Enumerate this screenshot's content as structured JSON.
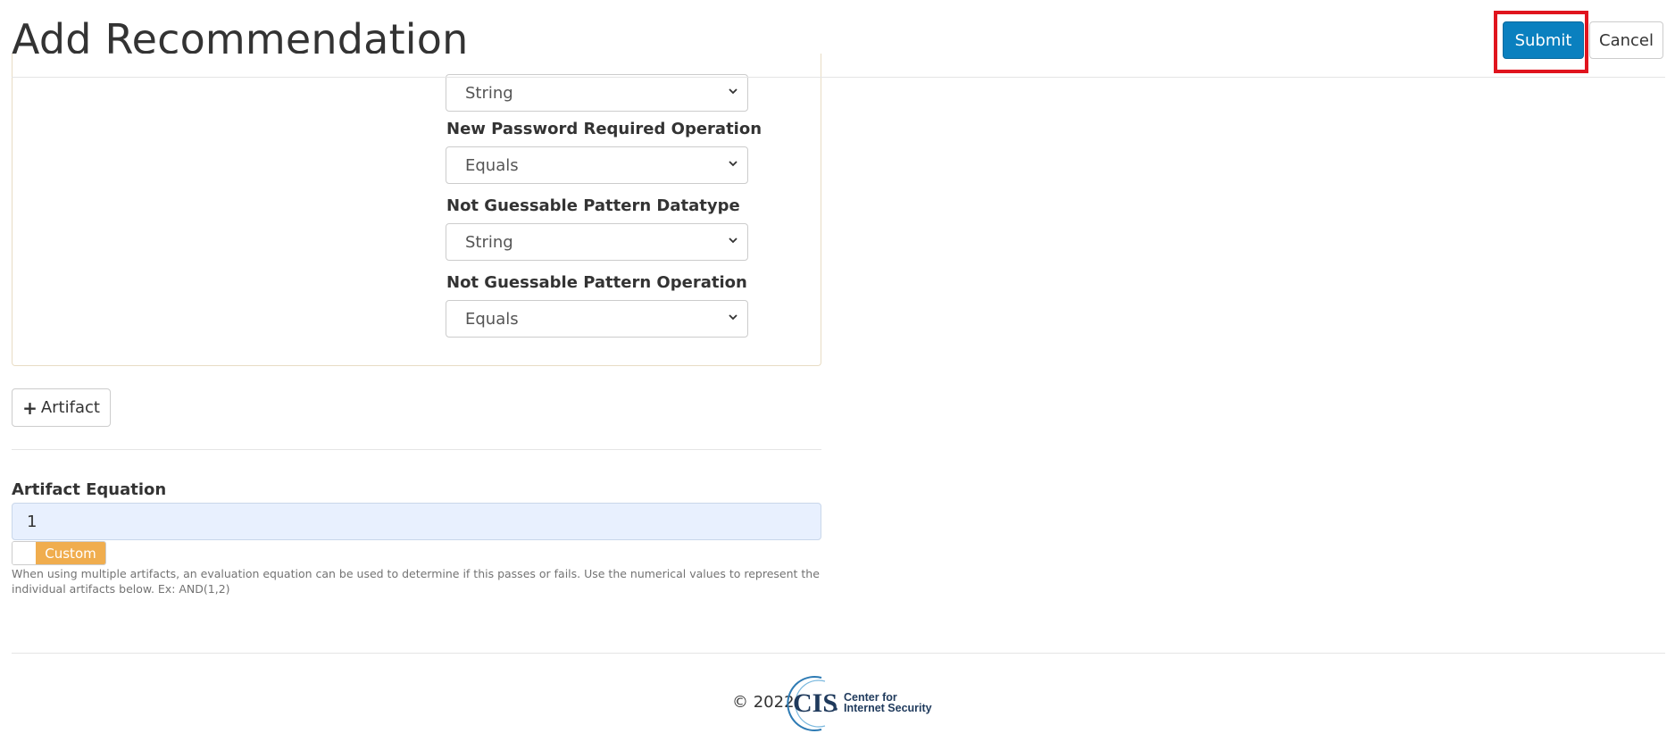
{
  "header": {
    "title": "Add Recommendation",
    "submit_label": "Submit",
    "cancel_label": "Cancel"
  },
  "artifact": {
    "top_select_value": "String",
    "fields": [
      {
        "label": "New Password Required Operation",
        "value": "Equals"
      },
      {
        "label": "Not Guessable Pattern Datatype",
        "value": "String"
      },
      {
        "label": "Not Guessable Pattern Operation",
        "value": "Equals"
      }
    ]
  },
  "add_artifact": {
    "label": "Artifact",
    "icon": "plus-icon"
  },
  "equation": {
    "label": "Artifact Equation",
    "value": "1",
    "toggle_label": "Custom",
    "help": "When using multiple artifacts, an evaluation equation can be used to determine if this passes or fails. Use the numerical values to represent the individual artifacts below. Ex: AND(1,2)"
  },
  "footer": {
    "copyright": "© 2022",
    "logo_mark": "CIS",
    "logo_line1": "Center for",
    "logo_line2": "Internet Security"
  },
  "colors": {
    "submit": "#0a80bf",
    "highlight": "#e0141e",
    "toggle": "#f0ad4e",
    "input_bg": "#e8f0fe"
  }
}
